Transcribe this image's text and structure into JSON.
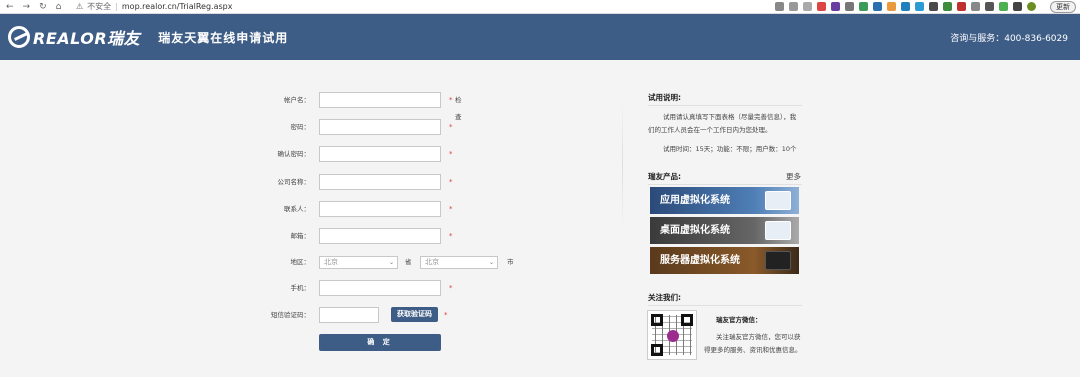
{
  "browser": {
    "security_label": "不安全",
    "url": "mop.realor.cn/TrialReg.aspx",
    "update_label": "更新"
  },
  "header": {
    "logo_text": "REALOR瑞友",
    "title": "瑞友天翼在线申请试用",
    "contact": "咨询与服务：400-836-6029"
  },
  "form": {
    "fields": [
      {
        "label": "帐户名：",
        "required": "*",
        "extra": "检查"
      },
      {
        "label": "密码：",
        "required": "*"
      },
      {
        "label": "确认密码：",
        "required": "*"
      },
      {
        "label": "公司名称：",
        "required": "*"
      },
      {
        "label": "联系人：",
        "required": "*"
      },
      {
        "label": "邮箱：",
        "required": "*"
      }
    ],
    "region": {
      "label": "地区：",
      "province_value": "北京",
      "province_unit": "省",
      "city_value": "北京",
      "city_unit": "市"
    },
    "phone": {
      "label": "手机：",
      "required": "*"
    },
    "sms": {
      "label": "短信验证码：",
      "button": "获取验证码",
      "required": "*"
    },
    "submit_label": "确 定"
  },
  "right": {
    "trial_title": "试用说明:",
    "trial_text_1": "试用请认真填写下面表格（尽量完善信息），我",
    "trial_text_2": "们的工作人员会在一个工作日内为您处理。",
    "trial_terms": "试用时间：15天；功能：不限；用户数：10个",
    "products_title": "瑞友产品:",
    "more_label": "更多",
    "products": [
      "应用虚拟化系统",
      "桌面虚拟化系统",
      "服务器虚拟化系统"
    ],
    "follow_title": "关注我们:",
    "wechat_title": "瑞友官方微信：",
    "wechat_text_1": "关注瑞友官方微信，您可以获",
    "wechat_text_2": "得更多的服务、资讯和优惠信息。"
  }
}
